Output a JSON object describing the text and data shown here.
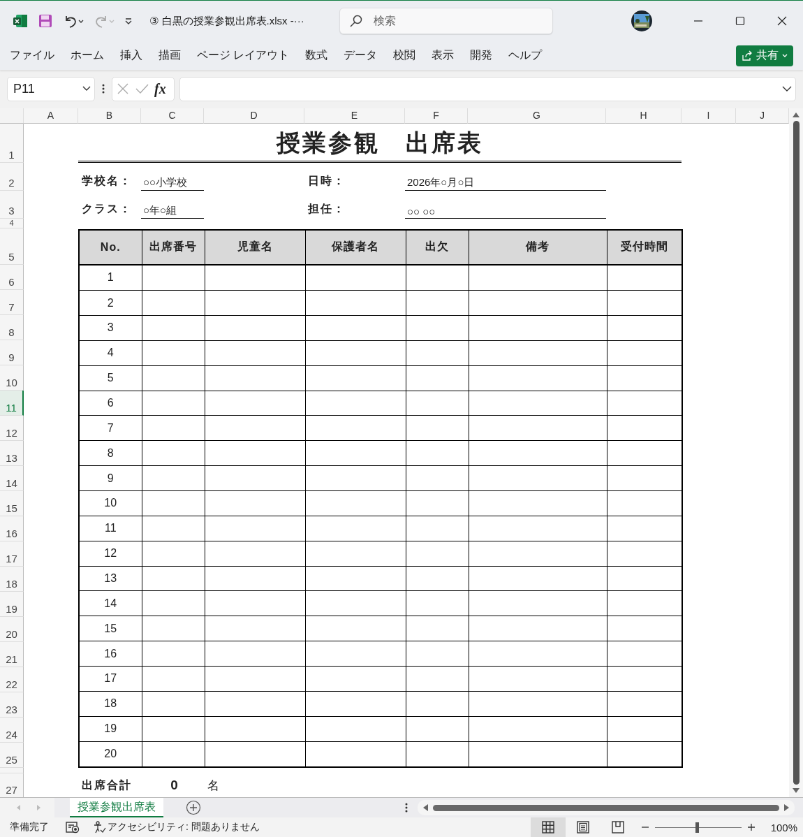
{
  "window": {
    "title": "③ 白黒の授業参観出席表.xlsx  -···",
    "search": {
      "placeholder": "検索"
    }
  },
  "ribbon_tabs": [
    "ファイル",
    "ホーム",
    "挿入",
    "描画",
    "ページ レイアウト",
    "数式",
    "データ",
    "校閲",
    "表示",
    "開発",
    "ヘルプ"
  ],
  "share_button": {
    "label": "共有"
  },
  "formula_bar": {
    "name_box": "P11",
    "function_label": "fx"
  },
  "sheet": {
    "columns": [
      "A",
      "B",
      "C",
      "D",
      "E",
      "F",
      "G",
      "H",
      "I",
      "J"
    ],
    "rows": [
      {
        "label": "1",
        "selected": false
      },
      {
        "label": "2",
        "selected": false
      },
      {
        "label": "3",
        "selected": false
      },
      {
        "label": "4",
        "selected": false
      },
      {
        "label": "5",
        "selected": false
      },
      {
        "label": "6",
        "selected": false
      },
      {
        "label": "7",
        "selected": false
      },
      {
        "label": "8",
        "selected": false
      },
      {
        "label": "9",
        "selected": false
      },
      {
        "label": "10",
        "selected": false
      },
      {
        "label": "11",
        "selected": true
      },
      {
        "label": "12",
        "selected": false
      },
      {
        "label": "13",
        "selected": false
      },
      {
        "label": "14",
        "selected": false
      },
      {
        "label": "15",
        "selected": false
      },
      {
        "label": "16",
        "selected": false
      },
      {
        "label": "17",
        "selected": false
      },
      {
        "label": "18",
        "selected": false
      },
      {
        "label": "19",
        "selected": false
      },
      {
        "label": "20",
        "selected": false
      },
      {
        "label": "21",
        "selected": false
      },
      {
        "label": "22",
        "selected": false
      },
      {
        "label": "23",
        "selected": false
      },
      {
        "label": "24",
        "selected": false
      },
      {
        "label": "25",
        "selected": false
      },
      {
        "selected": false
      },
      {
        "label": "27",
        "selected": false
      }
    ],
    "title": "授業参観　出席表",
    "info": [
      {
        "label": "学校名：",
        "value": "○○小学校"
      },
      {
        "label": "日時：",
        "value": "2026年○月○日"
      },
      {
        "label": "クラス：",
        "value": "○年○組"
      },
      {
        "label": "担任：",
        "value": "○○ ○○"
      }
    ],
    "table": {
      "columns": [
        "No.",
        "出席番号",
        "児童名",
        "保護者名",
        "出欠",
        "備考",
        "受付時間"
      ],
      "rows": [
        {
          "no": "1"
        },
        {
          "no": "2"
        },
        {
          "no": "3"
        },
        {
          "no": "4"
        },
        {
          "no": "5"
        },
        {
          "no": "6"
        },
        {
          "no": "7"
        },
        {
          "no": "8"
        },
        {
          "no": "9"
        },
        {
          "no": "10"
        },
        {
          "no": "11"
        },
        {
          "no": "12"
        },
        {
          "no": "13"
        },
        {
          "no": "14"
        },
        {
          "no": "15"
        },
        {
          "no": "16"
        },
        {
          "no": "17"
        },
        {
          "no": "18"
        },
        {
          "no": "19"
        },
        {
          "no": "20"
        }
      ]
    },
    "total": {
      "label": "出席合計",
      "value": "0",
      "unit": "名"
    }
  },
  "sheet_tabs": [
    {
      "label": "授業参観出席表",
      "selected": true
    }
  ],
  "status_bar": {
    "status": "準備完了",
    "accessibility": "アクセシビリティ: 問題ありません",
    "views": [
      {
        "kind": "normal",
        "selected": true
      },
      {
        "kind": "page_layout",
        "selected": false
      },
      {
        "kind": "page_break",
        "selected": false
      }
    ],
    "zoom": {
      "level": 0.49,
      "reading": "100%"
    }
  }
}
